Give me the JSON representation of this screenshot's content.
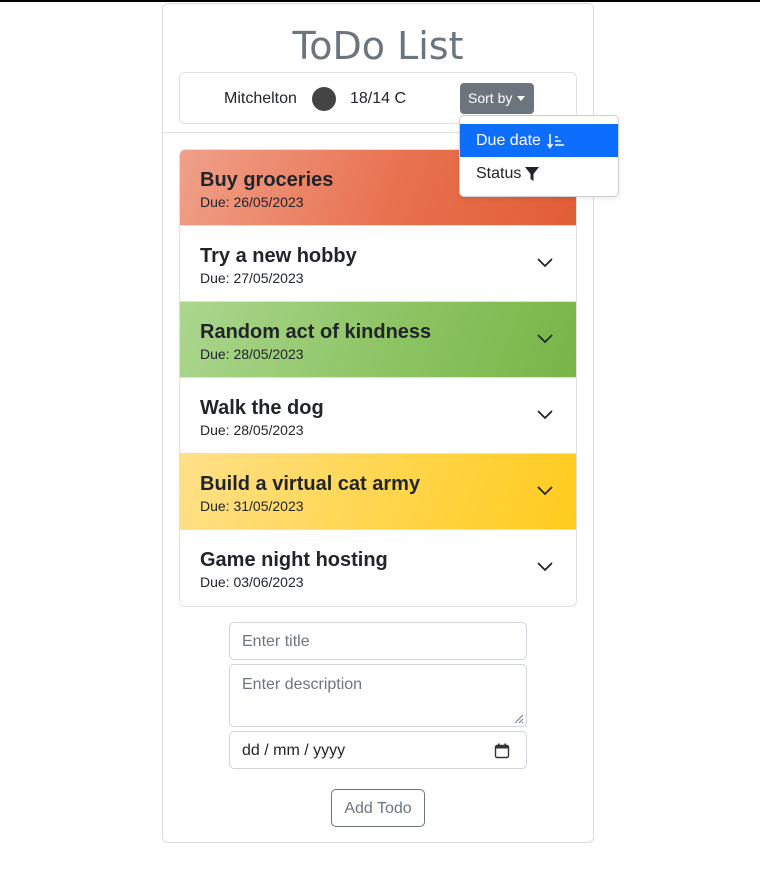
{
  "app": {
    "title": "ToDo List"
  },
  "weather": {
    "location": "Mitchelton",
    "icon": "weather-circle-icon",
    "temperature": "18/14 C"
  },
  "sort": {
    "button_label": "Sort by",
    "options": [
      {
        "label": "Due date",
        "icon": "sort-ascending-icon",
        "selected": true
      },
      {
        "label": "Status",
        "icon": "filter-icon",
        "selected": false
      }
    ]
  },
  "todos": [
    {
      "title": "Buy groceries",
      "due": "Due: 26/05/2023",
      "color": "#e8714f"
    },
    {
      "title": "Try a new hobby",
      "due": "Due: 27/05/2023",
      "color": "#ffffff"
    },
    {
      "title": "Random act of kindness",
      "due": "Due: 28/05/2023",
      "color": "#8cc463"
    },
    {
      "title": "Walk the dog",
      "due": "Due: 28/05/2023",
      "color": "#ffffff"
    },
    {
      "title": "Build a virtual cat army",
      "due": "Due: 31/05/2023",
      "color": "#ffd54a"
    },
    {
      "title": "Game night hosting",
      "due": "Due: 03/06/2023",
      "color": "#ffffff"
    }
  ],
  "form": {
    "title_placeholder": "Enter title",
    "description_placeholder": "Enter description",
    "date_value": "dd / mm / yyyy",
    "add_label": "Add Todo"
  },
  "colors": {
    "accent": "#0d6efd",
    "secondary": "#6c757d"
  }
}
